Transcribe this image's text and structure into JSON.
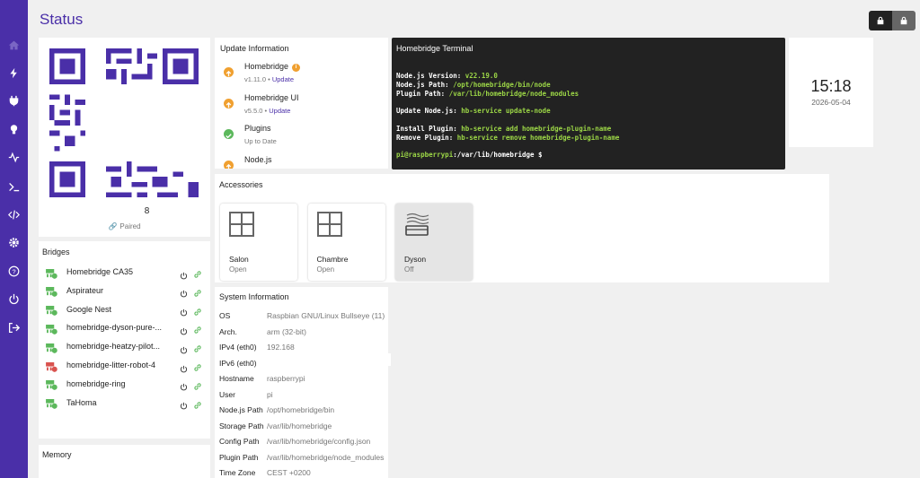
{
  "page": {
    "title": "Status"
  },
  "sidebar": {
    "items": [
      "home-icon",
      "bolt-icon",
      "plug-icon",
      "bulb-icon",
      "pulse-icon",
      "terminal-icon",
      "code-icon",
      "gear-icon",
      "help-icon",
      "power-icon",
      "logout-icon"
    ]
  },
  "qr": {
    "code_fragment": "8",
    "status": "Paired"
  },
  "bridges": {
    "title": "Bridges",
    "items": [
      {
        "name": "Homebridge CA35",
        "status": "ok"
      },
      {
        "name": "Aspirateur",
        "status": "ok"
      },
      {
        "name": "Google Nest",
        "status": "ok"
      },
      {
        "name": "homebridge-dyson-pure-...",
        "status": "ok"
      },
      {
        "name": "homebridge-heatzy-pilot...",
        "status": "ok"
      },
      {
        "name": "homebridge-litter-robot-4",
        "status": "error"
      },
      {
        "name": "homebridge-ring",
        "status": "ok"
      },
      {
        "name": "TaHoma",
        "status": "ok"
      }
    ]
  },
  "memory": {
    "title": "Memory"
  },
  "updates": {
    "title": "Update Information",
    "items": [
      {
        "name": "Homebridge",
        "version": "v1.11.0",
        "action": "Update",
        "state": "update"
      },
      {
        "name": "Homebridge UI",
        "version": "v5.5.0",
        "action": "Update",
        "state": "update"
      },
      {
        "name": "Plugins",
        "version": "Up to Date",
        "action": "",
        "state": "ok"
      },
      {
        "name": "Node.js",
        "version": "",
        "action": "",
        "state": "update"
      }
    ],
    "separator": " • "
  },
  "terminal": {
    "title": "Homebridge Terminal",
    "lines": [
      {
        "label": "Node.js Version:",
        "value": "v22.19.0"
      },
      {
        "label": "Node.js Path:",
        "value": "/opt/homebridge/bin/node"
      },
      {
        "label": "Plugin Path:",
        "value": "/var/lib/homebridge/node_modules"
      },
      {
        "label": "",
        "value": ""
      },
      {
        "label": "Update Node.js:",
        "value": "hb-service update-node"
      },
      {
        "label": "",
        "value": ""
      },
      {
        "label": "Install Plugin:",
        "value": "hb-service add homebridge-plugin-name"
      },
      {
        "label": "Remove Plugin:",
        "value": "hb-service remove homebridge-plugin-name"
      },
      {
        "label": "",
        "value": ""
      },
      {
        "label": "pi@raspberrypi",
        "value": ":/var/lib/homebridge $"
      }
    ]
  },
  "clock": {
    "time": "15:18",
    "date": "2026-05-04"
  },
  "accessories": {
    "title": "Accessories",
    "items": [
      {
        "name": "Salon",
        "state": "Open",
        "icon": "window-icon",
        "on": true
      },
      {
        "name": "Chambre",
        "state": "Open",
        "icon": "window-icon",
        "on": true
      },
      {
        "name": "Dyson",
        "state": "Off",
        "icon": "air-purifier-icon",
        "on": false
      }
    ]
  },
  "system": {
    "title": "System Information",
    "rows": [
      {
        "key": "OS",
        "value": "Raspbian GNU/Linux Bullseye (11)"
      },
      {
        "key": "Arch.",
        "value": "arm (32-bit)"
      },
      {
        "key": "IPv4 (eth0)",
        "value": "192.168"
      },
      {
        "key": "IPv6 (eth0)",
        "value": ""
      },
      {
        "key": "Hostname",
        "value": "raspberrypi"
      },
      {
        "key": "User",
        "value": "pi"
      },
      {
        "key": "Node.js Path",
        "value": "/opt/homebridge/bin"
      },
      {
        "key": "Storage Path",
        "value": "/var/lib/homebridge"
      },
      {
        "key": "Config Path",
        "value": "/var/lib/homebridge/config.json"
      },
      {
        "key": "Plugin Path",
        "value": "/var/lib/homebridge/node_modules"
      },
      {
        "key": "Time Zone",
        "value": "CEST +0200"
      }
    ]
  },
  "colors": {
    "accent": "#4a2fa8",
    "ok": "#5cb85c",
    "warn": "#f0a030",
    "error": "#d9534f",
    "terminal_green": "#9bd546"
  }
}
